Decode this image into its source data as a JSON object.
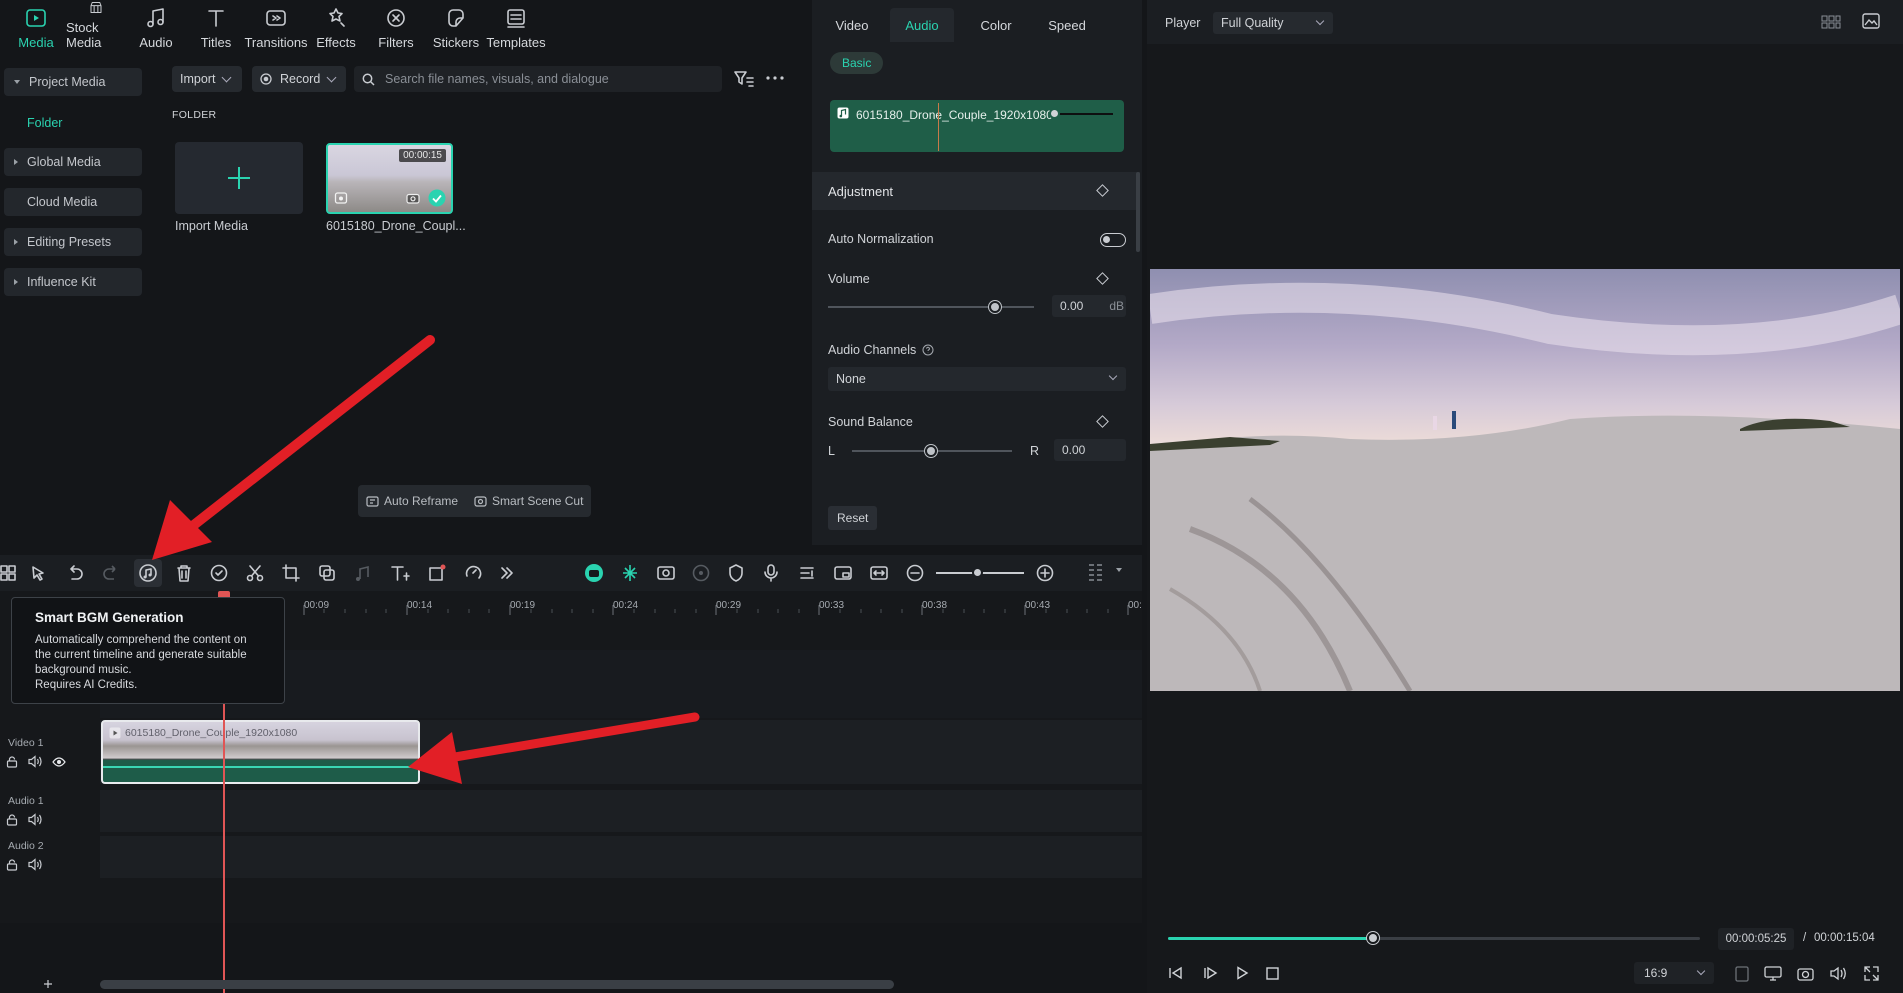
{
  "media_tabs": [
    {
      "label": "Media",
      "icon": "media-icon",
      "active": true
    },
    {
      "label": "Stock Media",
      "icon": "stock-media-icon"
    },
    {
      "label": "Audio",
      "icon": "music-note-icon"
    },
    {
      "label": "Titles",
      "icon": "text-icon"
    },
    {
      "label": "Transitions",
      "icon": "transitions-icon"
    },
    {
      "label": "Effects",
      "icon": "effects-icon"
    },
    {
      "label": "Filters",
      "icon": "filters-icon"
    },
    {
      "label": "Stickers",
      "icon": "stickers-icon"
    },
    {
      "label": "Templates",
      "icon": "templates-icon"
    }
  ],
  "sidebar": {
    "project_media": "Project Media",
    "folder": "Folder",
    "global_media": "Global Media",
    "cloud_media": "Cloud Media",
    "editing_presets": "Editing Presets",
    "influence_kit": "Influence Kit"
  },
  "media_toolbar": {
    "import_label": "Import",
    "record_label": "Record",
    "search_placeholder": "Search file names, visuals, and dialogue"
  },
  "media_area": {
    "folder_heading": "FOLDER",
    "import_media_label": "Import Media",
    "clip_name": "6015180_Drone_Coupl...",
    "clip_duration": "00:00:15"
  },
  "ai_tools": {
    "auto_reframe": "Auto Reframe",
    "smart_scene_cut": "Smart Scene Cut"
  },
  "inspector": {
    "tabs": [
      "Video",
      "Audio",
      "Color",
      "Speed"
    ],
    "active_tab": "Audio",
    "basic_label": "Basic",
    "clip_name": "6015180_Drone_Couple_1920x1080",
    "adjustment_label": "Adjustment",
    "auto_normalization_label": "Auto Normalization",
    "volume_label": "Volume",
    "volume_value": "0.00",
    "volume_unit": "dB",
    "audio_channels_label": "Audio Channels",
    "audio_channels_value": "None",
    "sound_balance_label": "Sound Balance",
    "balance_left": "L",
    "balance_right": "R",
    "balance_value": "0.00",
    "reset_label": "Reset"
  },
  "player": {
    "label": "Player",
    "quality": "Full Quality",
    "current_time": "00:00:05:25",
    "separator": "/",
    "total_time": "00:00:15:04",
    "aspect_ratio": "16:9",
    "progress_fraction": 0.385
  },
  "timeline": {
    "ruler_ticks": [
      "00:09",
      "00:14",
      "00:19",
      "00:24",
      "00:29",
      "00:33",
      "00:38",
      "00:43",
      "00:"
    ],
    "tracks": [
      "Video 1",
      "Audio 1",
      "Audio 2"
    ],
    "clip_label": "6015180_Drone_Couple_1920x1080"
  },
  "tooltip": {
    "title": "Smart BGM Generation",
    "lines": [
      "Automatically comprehend the content on",
      "the current timeline and generate suitable",
      "background music.",
      "Requires AI Credits."
    ]
  },
  "colors": {
    "accent": "#2ad3b0",
    "annotation_arrow": "#e21f26",
    "playhead": "#e05555"
  }
}
